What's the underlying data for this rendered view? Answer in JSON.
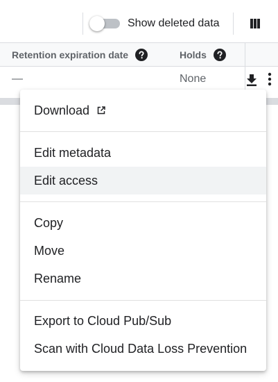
{
  "toolbar": {
    "show_deleted_label": "Show deleted data",
    "show_deleted_on": false,
    "icons": {
      "columns": "columns-icon"
    }
  },
  "table": {
    "headers": {
      "retention": "Retention expiration date",
      "holds": "Holds"
    },
    "row": {
      "retention": "—",
      "holds": "None"
    },
    "icons": {
      "help": "help-icon",
      "download": "download-icon",
      "more": "more-vert-icon"
    }
  },
  "menu": {
    "download": "Download",
    "download_icon": "open-in-new-icon",
    "edit_metadata": "Edit metadata",
    "edit_access": "Edit access",
    "copy": "Copy",
    "move": "Move",
    "rename": "Rename",
    "export_pubsub": "Export to Cloud Pub/Sub",
    "scan_dlp": "Scan with Cloud Data Loss Prevention",
    "hovered_item": "edit_access"
  },
  "colors": {
    "text_primary": "#202124",
    "text_secondary": "#5f6368",
    "divider": "#dadce0",
    "hover": "#f1f3f4"
  }
}
